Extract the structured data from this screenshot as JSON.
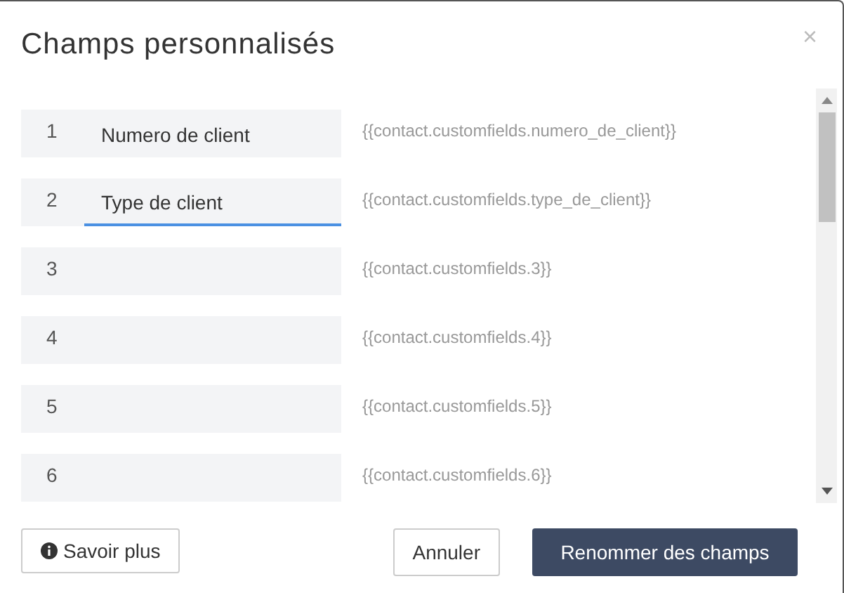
{
  "dialog": {
    "title": "Champs personnalisés",
    "close": "×"
  },
  "fields": [
    {
      "number": "1",
      "value": "Numero de client",
      "focused": false,
      "tag": "{{contact.customfields.numero_de_client}}"
    },
    {
      "number": "2",
      "value": "Type de client",
      "focused": true,
      "tag": "{{contact.customfields.type_de_client}}"
    },
    {
      "number": "3",
      "focused": false,
      "tag": "{{contact.customfields.3}}"
    },
    {
      "number": "4",
      "focused": false,
      "tag": "{{contact.customfields.4}}"
    },
    {
      "number": "5",
      "focused": false,
      "tag": "{{contact.customfields.5}}"
    },
    {
      "number": "6",
      "focused": false,
      "tag": "{{contact.customfields.6}}"
    }
  ],
  "buttons": {
    "learn_more": "Savoir plus",
    "cancel": "Annuler",
    "submit": "Renommer des champs"
  }
}
